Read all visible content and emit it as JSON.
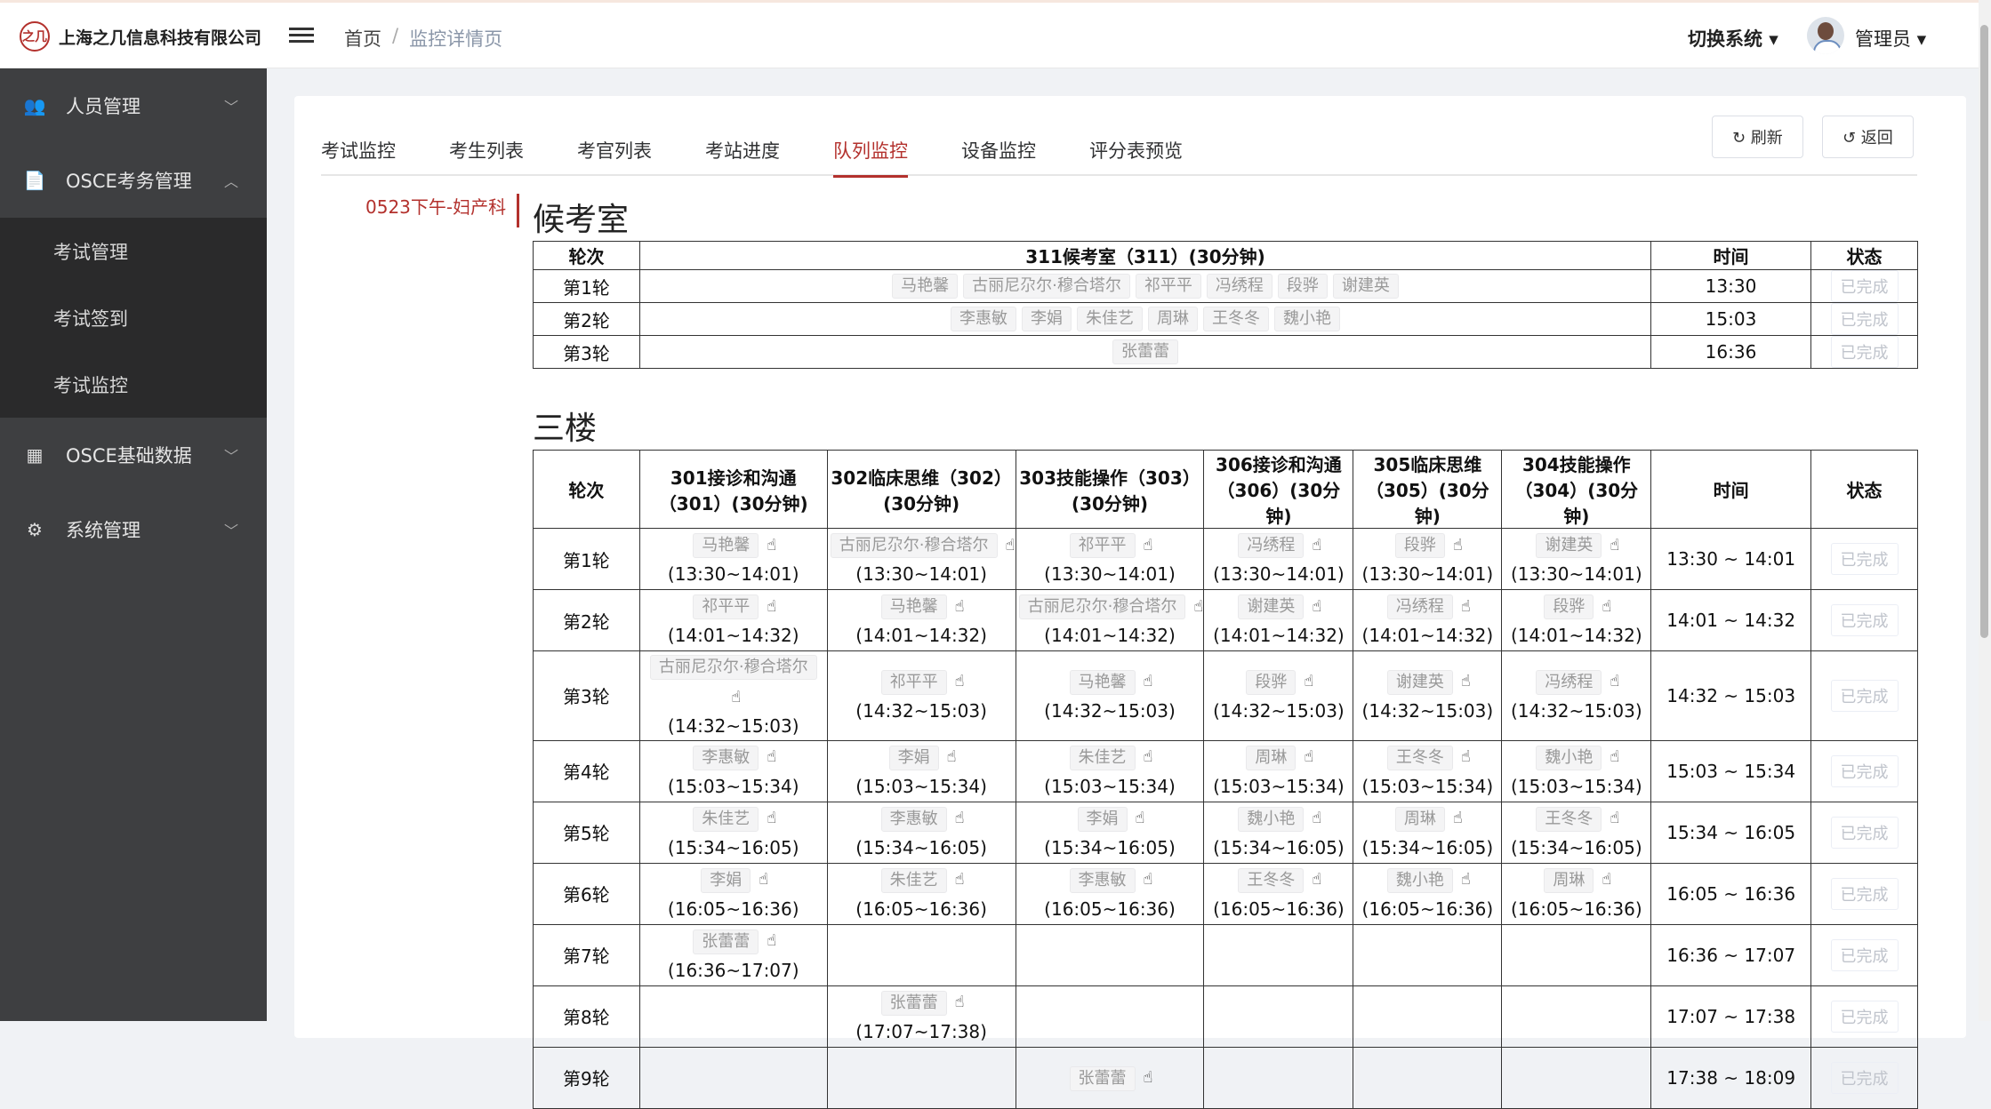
{
  "header": {
    "logo_mark": "之几",
    "company": "上海之几信息科技有限公司",
    "breadcrumb_home": "首页",
    "breadcrumb_sep": "/",
    "breadcrumb_current": "监控详情页",
    "switch_system": "切换系统 ▾",
    "user_name": "管理员 ▾"
  },
  "sidebar": {
    "items": [
      {
        "label": "人员管理",
        "icon": "👥"
      },
      {
        "label": "OSCE考务管理",
        "icon": "📄"
      },
      {
        "label": "OSCE基础数据",
        "icon": "▦"
      },
      {
        "label": "系统管理",
        "icon": "⚙"
      }
    ],
    "subitems": [
      "考试管理",
      "考试签到",
      "考试监控"
    ],
    "chev_down": "﹀",
    "chev_up": "︿"
  },
  "tabs": [
    "考试监控",
    "考生列表",
    "考官列表",
    "考站进度",
    "队列监控",
    "设备监控",
    "评分表预览"
  ],
  "buttons": {
    "refresh": "↻ 刷新",
    "back": "↺ 返回"
  },
  "exam_name": "0523下午-妇产科",
  "waiting": {
    "title": "候考室",
    "headers": {
      "round": "轮次",
      "room": "311候考室（311）(30分钟)",
      "time": "时间",
      "status": "状态"
    },
    "rows": [
      {
        "round": "第1轮",
        "names": [
          "马艳馨",
          "古丽尼尕尔·穆合塔尔",
          "祁平平",
          "冯绣程",
          "段骅",
          "谢建英"
        ],
        "time": "13:30",
        "status": "已完成"
      },
      {
        "round": "第2轮",
        "names": [
          "李惠敏",
          "李娟",
          "朱佳艺",
          "周琳",
          "王冬冬",
          "魏小艳"
        ],
        "time": "15:03",
        "status": "已完成"
      },
      {
        "round": "第3轮",
        "names": [
          "张蕾蕾"
        ],
        "time": "16:36",
        "status": "已完成"
      }
    ]
  },
  "floor": {
    "title": "三楼",
    "headers": {
      "round": "轮次",
      "time": "时间",
      "status": "状态",
      "stations": [
        "301接诊和沟通（301）(30分钟)",
        "302临床思维（302）(30分钟)",
        "303技能操作（303）(30分钟)",
        "306接诊和沟通（306）(30分钟)",
        "305临床思维（305）(30分钟)",
        "304技能操作（304）(30分钟)"
      ]
    },
    "hand_icon": "☝",
    "rows": [
      {
        "round": "第1轮",
        "cells": [
          [
            "马艳馨",
            "(13:30~14:01)"
          ],
          [
            "古丽尼尕尔·穆合塔尔",
            "(13:30~14:01)"
          ],
          [
            "祁平平",
            "(13:30~14:01)"
          ],
          [
            "冯绣程",
            "(13:30~14:01)"
          ],
          [
            "段骅",
            "(13:30~14:01)"
          ],
          [
            "谢建英",
            "(13:30~14:01)"
          ]
        ],
        "time": "13:30 ~ 14:01",
        "status": "已完成"
      },
      {
        "round": "第2轮",
        "cells": [
          [
            "祁平平",
            "(14:01~14:32)"
          ],
          [
            "马艳馨",
            "(14:01~14:32)"
          ],
          [
            "古丽尼尕尔·穆合塔尔",
            "(14:01~14:32)"
          ],
          [
            "谢建英",
            "(14:01~14:32)"
          ],
          [
            "冯绣程",
            "(14:01~14:32)"
          ],
          [
            "段骅",
            "(14:01~14:32)"
          ]
        ],
        "time": "14:01 ~ 14:32",
        "status": "已完成"
      },
      {
        "round": "第3轮",
        "cells": [
          [
            "古丽尼尕尔·穆合塔尔",
            "(14:32~15:03)"
          ],
          [
            "祁平平",
            "(14:32~15:03)"
          ],
          [
            "马艳馨",
            "(14:32~15:03)"
          ],
          [
            "段骅",
            "(14:32~15:03)"
          ],
          [
            "谢建英",
            "(14:32~15:03)"
          ],
          [
            "冯绣程",
            "(14:32~15:03)"
          ]
        ],
        "time": "14:32 ~ 15:03",
        "status": "已完成"
      },
      {
        "round": "第4轮",
        "cells": [
          [
            "李惠敏",
            "(15:03~15:34)"
          ],
          [
            "李娟",
            "(15:03~15:34)"
          ],
          [
            "朱佳艺",
            "(15:03~15:34)"
          ],
          [
            "周琳",
            "(15:03~15:34)"
          ],
          [
            "王冬冬",
            "(15:03~15:34)"
          ],
          [
            "魏小艳",
            "(15:03~15:34)"
          ]
        ],
        "time": "15:03 ~ 15:34",
        "status": "已完成"
      },
      {
        "round": "第5轮",
        "cells": [
          [
            "朱佳艺",
            "(15:34~16:05)"
          ],
          [
            "李惠敏",
            "(15:34~16:05)"
          ],
          [
            "李娟",
            "(15:34~16:05)"
          ],
          [
            "魏小艳",
            "(15:34~16:05)"
          ],
          [
            "周琳",
            "(15:34~16:05)"
          ],
          [
            "王冬冬",
            "(15:34~16:05)"
          ]
        ],
        "time": "15:34 ~ 16:05",
        "status": "已完成"
      },
      {
        "round": "第6轮",
        "cells": [
          [
            "李娟",
            "(16:05~16:36)"
          ],
          [
            "朱佳艺",
            "(16:05~16:36)"
          ],
          [
            "李惠敏",
            "(16:05~16:36)"
          ],
          [
            "王冬冬",
            "(16:05~16:36)"
          ],
          [
            "魏小艳",
            "(16:05~16:36)"
          ],
          [
            "周琳",
            "(16:05~16:36)"
          ]
        ],
        "time": "16:05 ~ 16:36",
        "status": "已完成"
      },
      {
        "round": "第7轮",
        "cells": [
          [
            "张蕾蕾",
            "(16:36~17:07)"
          ],
          [],
          [],
          [],
          [],
          []
        ],
        "time": "16:36 ~ 17:07",
        "status": "已完成"
      },
      {
        "round": "第8轮",
        "cells": [
          [],
          [
            "张蕾蕾",
            "(17:07~17:38)"
          ],
          [],
          [],
          [],
          []
        ],
        "time": "17:07 ~ 17:38",
        "status": "已完成"
      },
      {
        "round": "第9轮",
        "cells": [
          [],
          [],
          [
            "张蕾蕾",
            ""
          ],
          [],
          [],
          []
        ],
        "time": "17:38 ~ 18:09",
        "status": "已完成"
      }
    ]
  }
}
